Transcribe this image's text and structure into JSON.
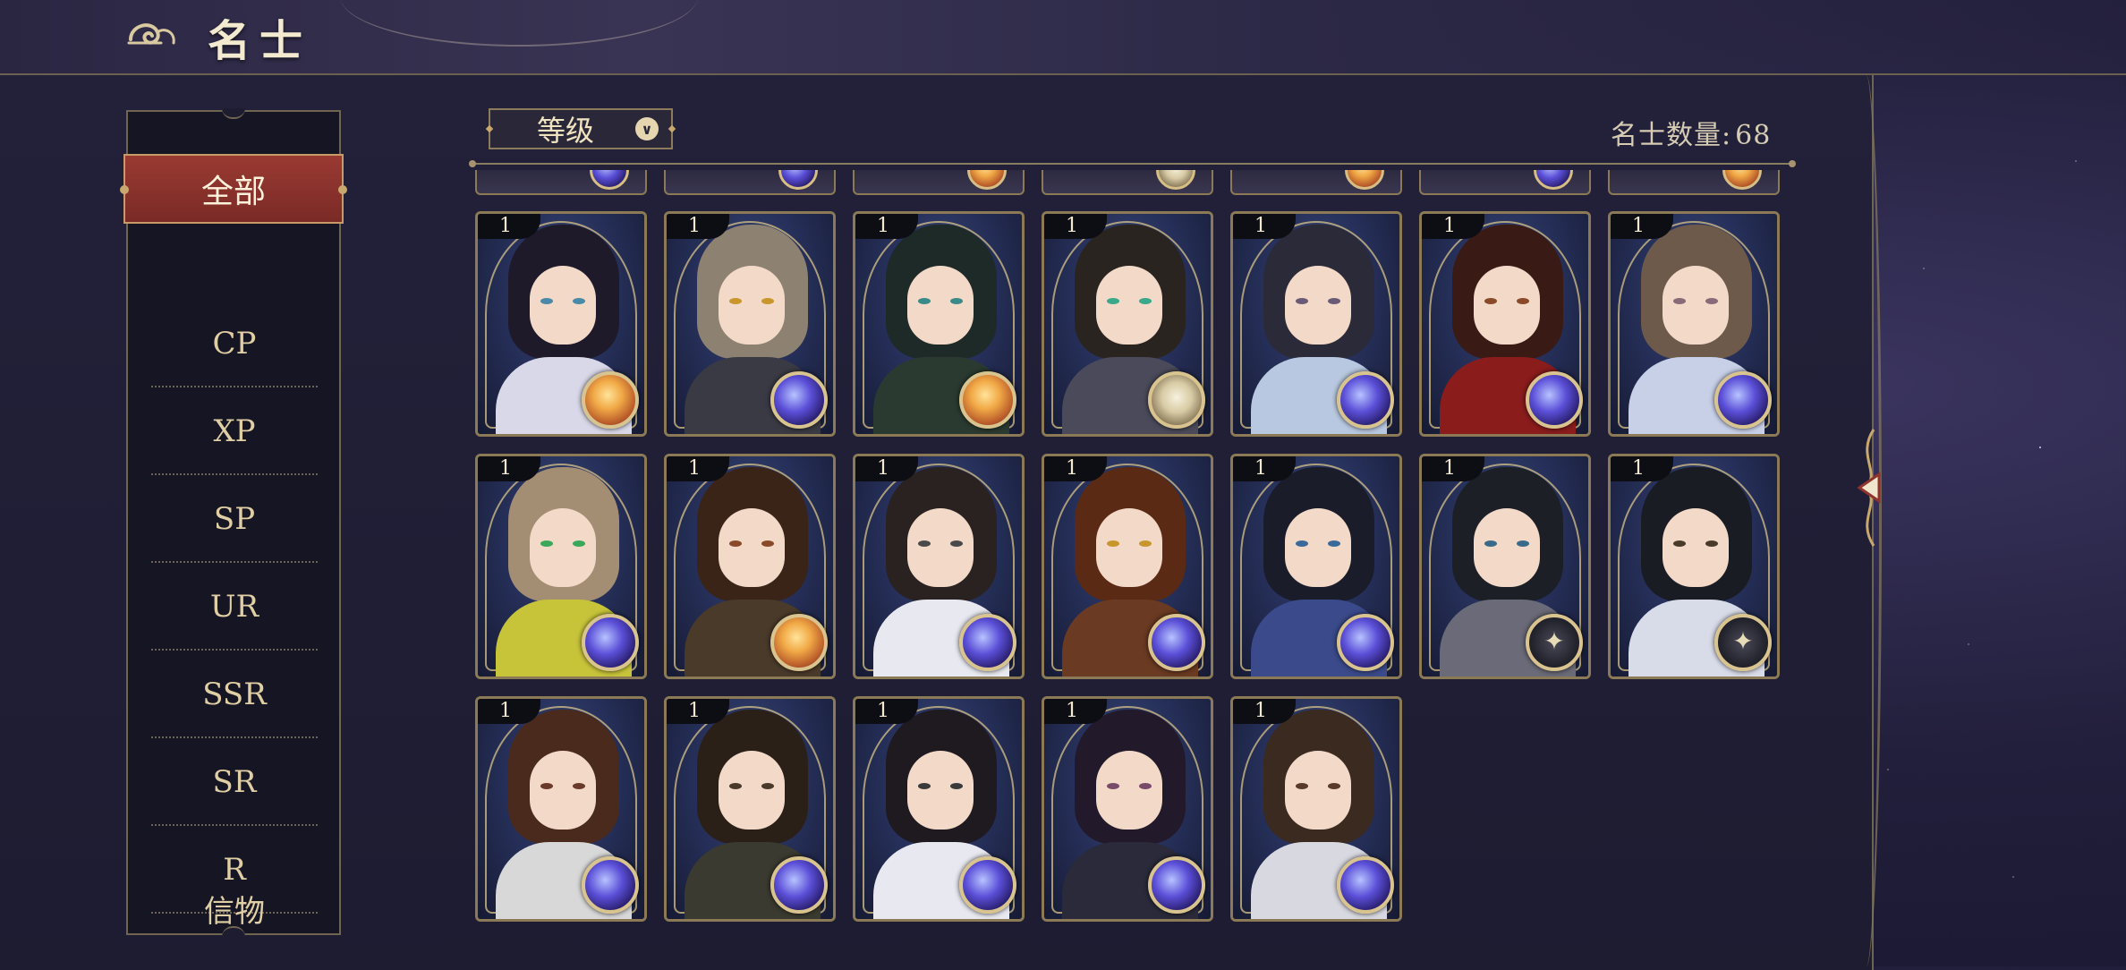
{
  "header": {
    "title": "名士"
  },
  "filters": {
    "active": "全部",
    "items": [
      "CP",
      "XP",
      "SP",
      "UR",
      "SSR",
      "SR",
      "R",
      "信物"
    ]
  },
  "sort": {
    "label": "等级"
  },
  "count": {
    "label": "名士数量:",
    "value": "68"
  },
  "colors": {
    "accent_red": "#8e342d",
    "gold_border": "#8b7a55",
    "text_gold": "#e0cfa4"
  },
  "cards": [
    {
      "level": "1",
      "orb": "gold"
    },
    {
      "level": "1",
      "orb": "purple"
    },
    {
      "level": "1",
      "orb": "gold"
    },
    {
      "level": "1",
      "orb": "silver"
    },
    {
      "level": "1",
      "orb": "purple"
    },
    {
      "level": "1",
      "orb": "purple"
    },
    {
      "level": "1",
      "orb": "purple"
    },
    {
      "level": "1",
      "orb": "purple"
    },
    {
      "level": "1",
      "orb": "gold"
    },
    {
      "level": "1",
      "orb": "purple"
    },
    {
      "level": "1",
      "orb": "purple"
    },
    {
      "level": "1",
      "orb": "purple"
    },
    {
      "level": "1",
      "orb": "dark"
    },
    {
      "level": "1",
      "orb": "dark"
    },
    {
      "level": "1",
      "orb": "purple"
    },
    {
      "level": "1",
      "orb": "purple"
    },
    {
      "level": "1",
      "orb": "purple"
    },
    {
      "level": "1",
      "orb": "purple"
    },
    {
      "level": "1",
      "orb": "purple"
    }
  ]
}
